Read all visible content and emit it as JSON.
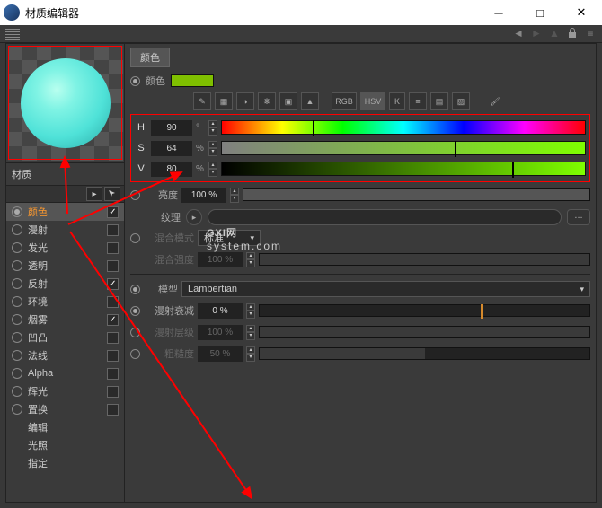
{
  "window": {
    "title": "材质编辑器"
  },
  "material": {
    "name": "材质"
  },
  "section": {
    "title": "颜色"
  },
  "color": {
    "label": "颜色",
    "swatch_hex": "#7fbf00",
    "icon_labels": {
      "rgb": "RGB",
      "hsv": "HSV",
      "k": "K"
    },
    "h": {
      "label": "H",
      "value": "90",
      "unit": "°",
      "marker_pct": 25
    },
    "s": {
      "label": "S",
      "value": "64",
      "unit": "%",
      "marker_pct": 64
    },
    "v": {
      "label": "V",
      "value": "80",
      "unit": "%",
      "marker_pct": 80
    }
  },
  "brightness": {
    "label": "亮度",
    "value": "100 %",
    "fill_pct": 100
  },
  "texture": {
    "label": "纹理",
    "btn": "..."
  },
  "blend_mode": {
    "label": "混合模式",
    "value": "标准"
  },
  "blend_strength": {
    "label": "混合强度",
    "value": "100 %",
    "fill_pct": 100
  },
  "model": {
    "label": "模型",
    "value": "Lambertian"
  },
  "falloff": {
    "label": "漫射衰减",
    "value": "0 %",
    "tick_pct": 67
  },
  "falloff_level": {
    "label": "漫射层级",
    "value": "100 %",
    "fill_pct": 100
  },
  "roughness": {
    "label": "粗糙度",
    "value": "50 %",
    "fill_pct": 50
  },
  "channels": [
    {
      "label": "颜色",
      "checked": true,
      "active": true
    },
    {
      "label": "漫射",
      "checked": false
    },
    {
      "label": "发光",
      "checked": false
    },
    {
      "label": "透明",
      "checked": false
    },
    {
      "label": "反射",
      "checked": true
    },
    {
      "label": "环境",
      "checked": false
    },
    {
      "label": "烟雾",
      "checked": true
    },
    {
      "label": "凹凸",
      "checked": false
    },
    {
      "label": "法线",
      "checked": false
    },
    {
      "label": "Alpha",
      "checked": false
    },
    {
      "label": "辉光",
      "checked": false
    },
    {
      "label": "置换",
      "checked": false
    }
  ],
  "sub_channels": [
    "编辑",
    "光照",
    "指定"
  ],
  "watermark": {
    "main": "GXI网",
    "sub": "system.com"
  }
}
